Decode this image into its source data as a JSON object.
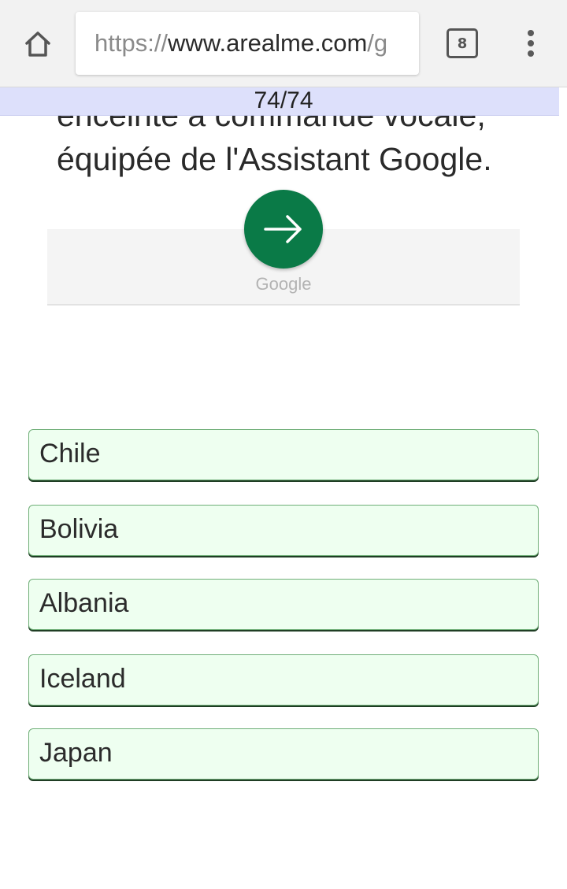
{
  "browser": {
    "url_scheme": "https://",
    "url_host": "www.arealme.com",
    "url_path": "/g",
    "tab_count": "8",
    "home_icon": "home-icon",
    "menu_icon": "more-vert-icon"
  },
  "quiz": {
    "progress": "74/74",
    "question_tail": "enceinte à commande vocale, équipée de l'Assistant Google.",
    "options": [
      "Chile",
      "Bolivia",
      "Albania",
      "Iceland",
      "Japan"
    ]
  },
  "ad": {
    "label": "Google",
    "button_icon": "arrow-right-icon",
    "button_color": "#0a7a47"
  },
  "colors": {
    "progress_bg": "#dde0fb",
    "option_bg": "#eefff0",
    "option_border": "#6fae77"
  }
}
